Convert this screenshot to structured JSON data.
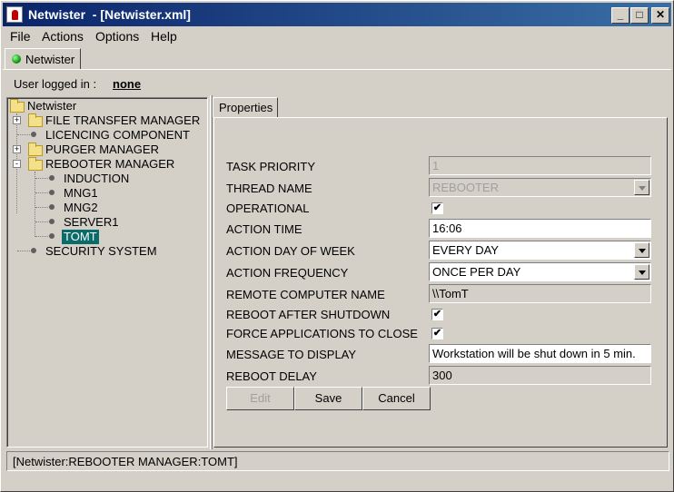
{
  "window": {
    "title": "Netwister  - [Netwister.xml]"
  },
  "menu": [
    "File",
    "Actions",
    "Options",
    "Help"
  ],
  "outer_tab": {
    "label": "Netwister",
    "status_color": "#00a000"
  },
  "user": {
    "label": "User logged in :",
    "value": "none"
  },
  "tree": {
    "root": "Netwister",
    "nodes": [
      {
        "label": "FILE TRANSFER MANAGER",
        "type": "folder",
        "expander": "+"
      },
      {
        "label": "LICENCING COMPONENT",
        "type": "leaf"
      },
      {
        "label": "PURGER MANAGER",
        "type": "folder",
        "expander": "+"
      },
      {
        "label": "REBOOTER MANAGER",
        "type": "folder",
        "expander": "-",
        "children": [
          "INDUCTION",
          "MNG1",
          "MNG2",
          "SERVER1",
          "TOMT"
        ]
      },
      {
        "label": "SECURITY SYSTEM",
        "type": "leaf"
      }
    ],
    "selected": "TOMT"
  },
  "properties_tab": "Properties",
  "form": {
    "task_priority": {
      "label": "TASK PRIORITY",
      "value": "1"
    },
    "thread_name": {
      "label": "THREAD NAME",
      "value": "REBOOTER"
    },
    "operational": {
      "label": "OPERATIONAL",
      "checked": true
    },
    "action_time": {
      "label": "ACTION TIME",
      "value": "16:06"
    },
    "action_day": {
      "label": "ACTION DAY OF WEEK",
      "value": "EVERY DAY"
    },
    "action_frequency": {
      "label": "ACTION FREQUENCY",
      "value": "ONCE PER DAY"
    },
    "remote_computer": {
      "label": "REMOTE COMPUTER NAME",
      "value": "\\\\TomT"
    },
    "reboot_after_shutdown": {
      "label": "REBOOT AFTER SHUTDOWN",
      "checked": true
    },
    "force_close": {
      "label": "FORCE APPLICATIONS TO CLOSE",
      "checked": true
    },
    "message": {
      "label": "MESSAGE TO DISPLAY",
      "value": "Workstation will be shut down in 5 min."
    },
    "reboot_delay": {
      "label": "REBOOT DELAY",
      "value": "300"
    }
  },
  "buttons": {
    "edit": "Edit",
    "save": "Save",
    "cancel": "Cancel"
  },
  "check_mark": "✔",
  "status": "[Netwister:REBOOTER MANAGER:TOMT]"
}
